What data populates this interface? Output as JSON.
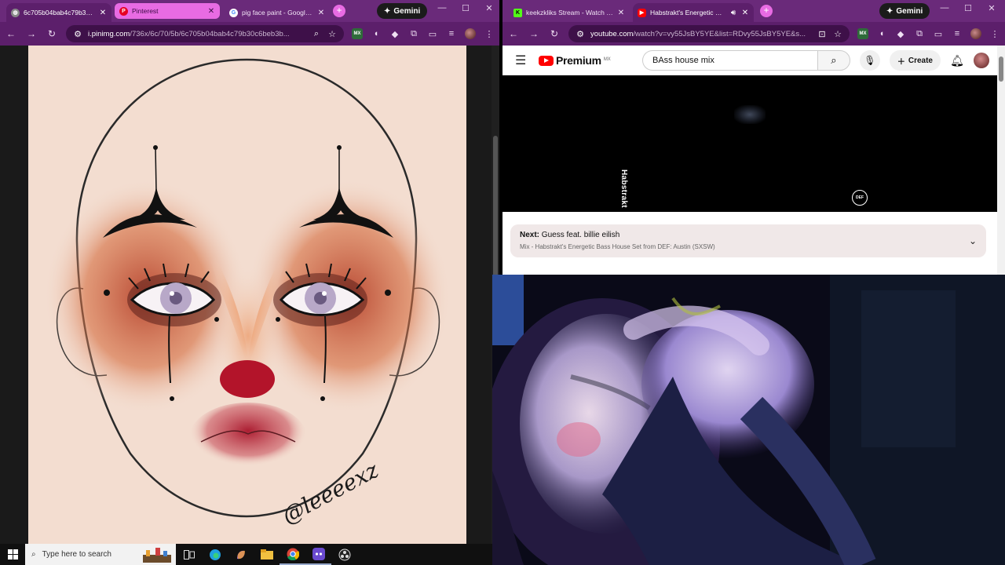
{
  "left_window": {
    "tabs": [
      {
        "title": "6c705b04bab4c79b30c6b",
        "state": "active",
        "favicon": "globe-favicon"
      },
      {
        "title": "Pinterest",
        "state": "pink",
        "favicon": "pinterest-favicon"
      },
      {
        "title": "pig face paint - Google S",
        "state": "inactive",
        "favicon": "google-favicon"
      }
    ],
    "gemini_label": "Gemini",
    "address": {
      "host": "i.pinimg.com",
      "path": "/736x/6c/70/5b/6c705b04bab4c79b30c6beb3b..."
    }
  },
  "right_window": {
    "tabs": [
      {
        "title": "keekzkliks Stream - Watch Live",
        "state": "inactive",
        "favicon": "kick-favicon"
      },
      {
        "title": "Habstrakt's Energetic Bass",
        "state": "active",
        "favicon": "youtube-favicon"
      }
    ],
    "gemini_label": "Gemini",
    "address": {
      "host": "youtube.com",
      "path": "/watch?v=vy55JsBY5YE&list=RDvy55JsBY5YE&s..."
    }
  },
  "artwork": {
    "watermark": "@leeeexz"
  },
  "youtube": {
    "logo_text": "Premium",
    "region": "MX",
    "search_value": "BAss house mix",
    "create_label": "Create",
    "player": {
      "channel_text": "Habstrakt",
      "badge": "DEF"
    },
    "up_next": {
      "label": "Next:",
      "title": "Guess feat. billie eilish",
      "subtitle": "Mix - Habstrakt's Energetic Bass House Set from DEF: Austin (SXSW)"
    }
  },
  "taskbar": {
    "search_placeholder": "Type here to search"
  },
  "colors": {
    "chrome_frame": "#6a2a7a",
    "chrome_toolbar": "#5c1f6b",
    "tab_pink": "#e86be3",
    "youtube_red": "#ff0000",
    "canvas_skin": "#f3ddd0"
  }
}
